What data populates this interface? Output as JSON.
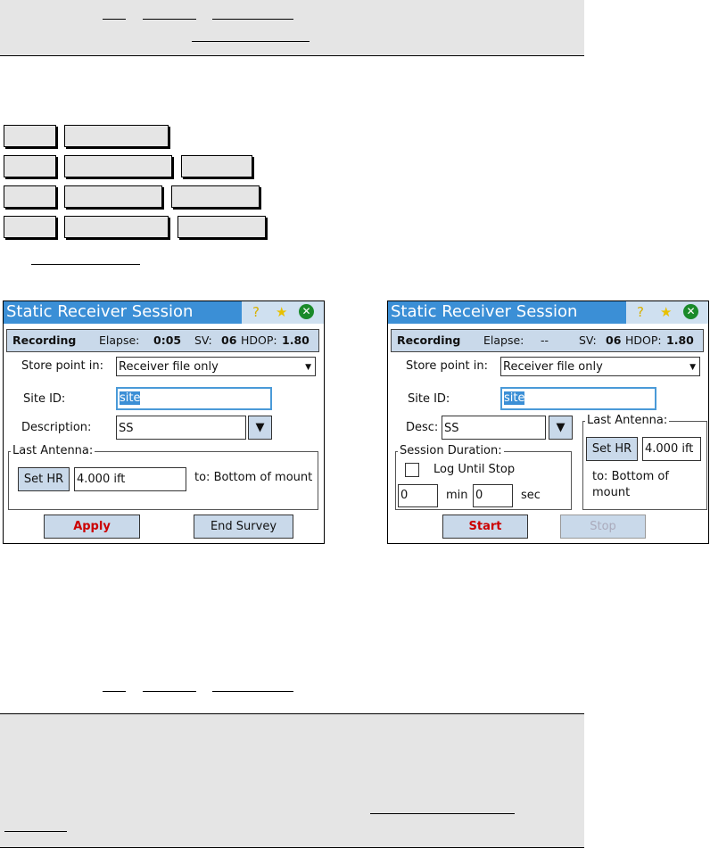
{
  "screens": [
    {
      "title": "Static Receiver Session",
      "status": {
        "state": "Recording",
        "elapse_label": "Elapse:",
        "elapse": "0:05",
        "sv_label": "SV:",
        "sv": "06",
        "hdop_label": "HDOP:",
        "hdop": "1.80"
      },
      "store_label": "Store point in:",
      "store_value": "Receiver file only",
      "site_label": "Site ID:",
      "site_value": "site",
      "desc_label": "Description:",
      "desc_value": "SS",
      "antenna_group": "Last Antenna:",
      "set_hr": "Set HR",
      "height": "4.000 ift",
      "to": "to: Bottom of mount",
      "btn1": "Apply",
      "btn2": "End Survey"
    },
    {
      "title": "Static Receiver Session",
      "status": {
        "state": "Recording",
        "elapse_label": "Elapse:",
        "elapse": "--",
        "sv_label": "SV:",
        "sv": "06",
        "hdop_label": "HDOP:",
        "hdop": "1.80"
      },
      "store_label": "Store point in:",
      "store_value": "Receiver file only",
      "site_label": "Site ID:",
      "site_value": "site",
      "desc_label": "Desc:",
      "desc_value": "SS",
      "duration_group": "Session Duration:",
      "log_until_stop": "Log Until Stop",
      "min_value": "0",
      "min_label": "min",
      "sec_value": "0",
      "sec_label": "sec",
      "antenna_group": "Last Antenna:",
      "set_hr": "Set HR",
      "height": "4.000 ift",
      "to": "to: Bottom of mount",
      "btn1": "Start",
      "btn2": "Stop"
    }
  ],
  "colors": {
    "title_bar": "#3b8fd6",
    "button": "#c9d9ea",
    "accent_red": "#cc0000"
  }
}
